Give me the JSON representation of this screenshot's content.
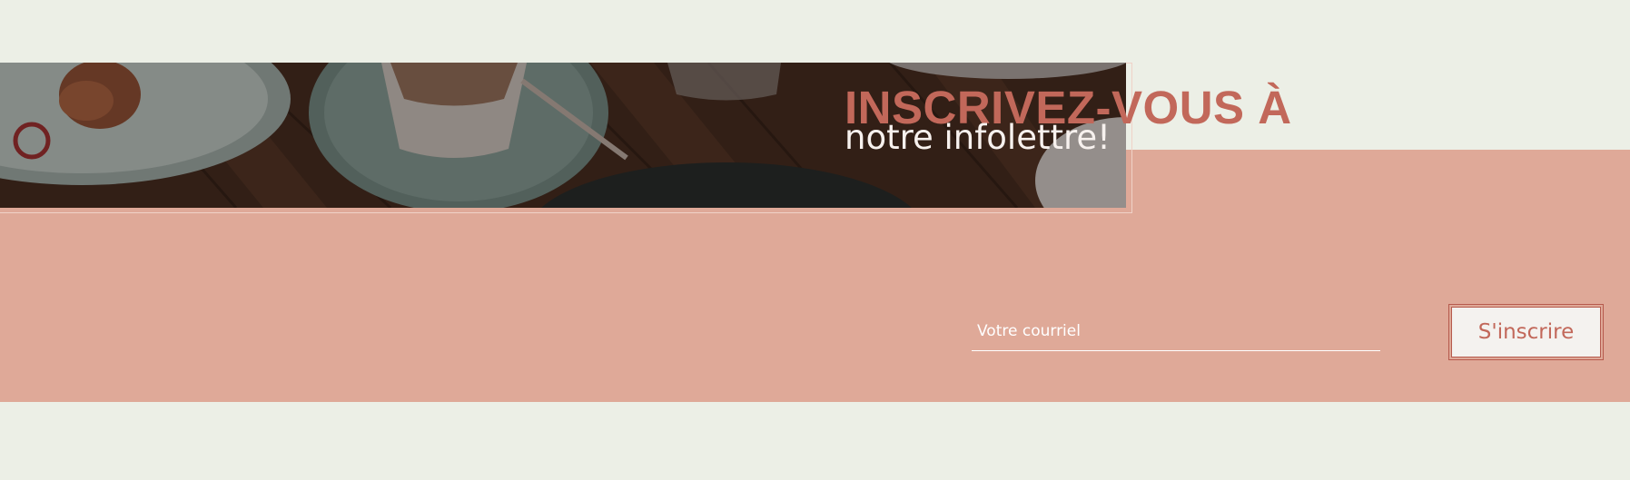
{
  "newsletter": {
    "headline": "INSCRIVEZ-VOUS À",
    "subheadline": "notre infolettre!",
    "email_placeholder": "Votre courriel",
    "email_value": "",
    "submit_label": "S'inscrire"
  },
  "colors": {
    "page_background": "#ecefe6",
    "band_background": "#dfa998",
    "accent": "#c2685a",
    "button_background": "#f4f2ef",
    "input_text": "#ffffff"
  }
}
